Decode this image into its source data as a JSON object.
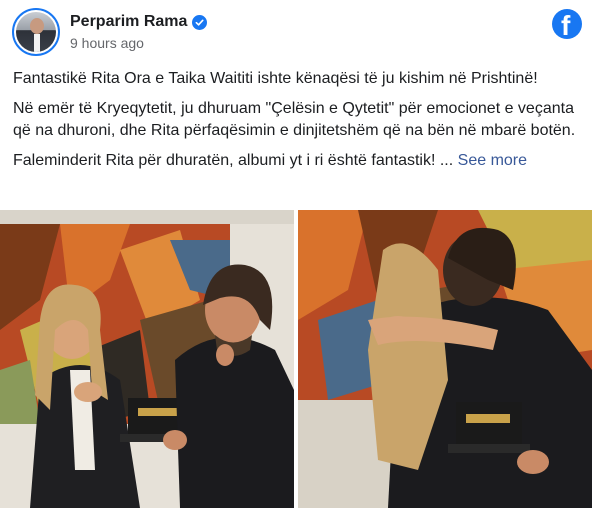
{
  "post": {
    "author": "Perparim Rama",
    "time": "9 hours ago",
    "verified_icon": "verified-badge-icon",
    "platform_icon": "facebook-icon",
    "paragraph_1": "Fantastikë Rita Ora e Taika Waititi ishte kënaqësi të ju kishim në Prishtinë!",
    "paragraph_2": "Në emër të Kryeqytetit, ju dhuruam \"Çelësin e Qytetit\" për emocionet e veçanta që na dhuroni, dhe Rita përfaqësimin e dinjitetshëm që na bën në mbarë botën.",
    "paragraph_3": "Faleminderit Rita për dhuratën, albumi yt i ri është fantastik! ...",
    "see_more": "See more"
  },
  "colors": {
    "brand": "#1877f2",
    "link": "#385898",
    "text": "#1c1e21",
    "muted": "#65676b"
  }
}
